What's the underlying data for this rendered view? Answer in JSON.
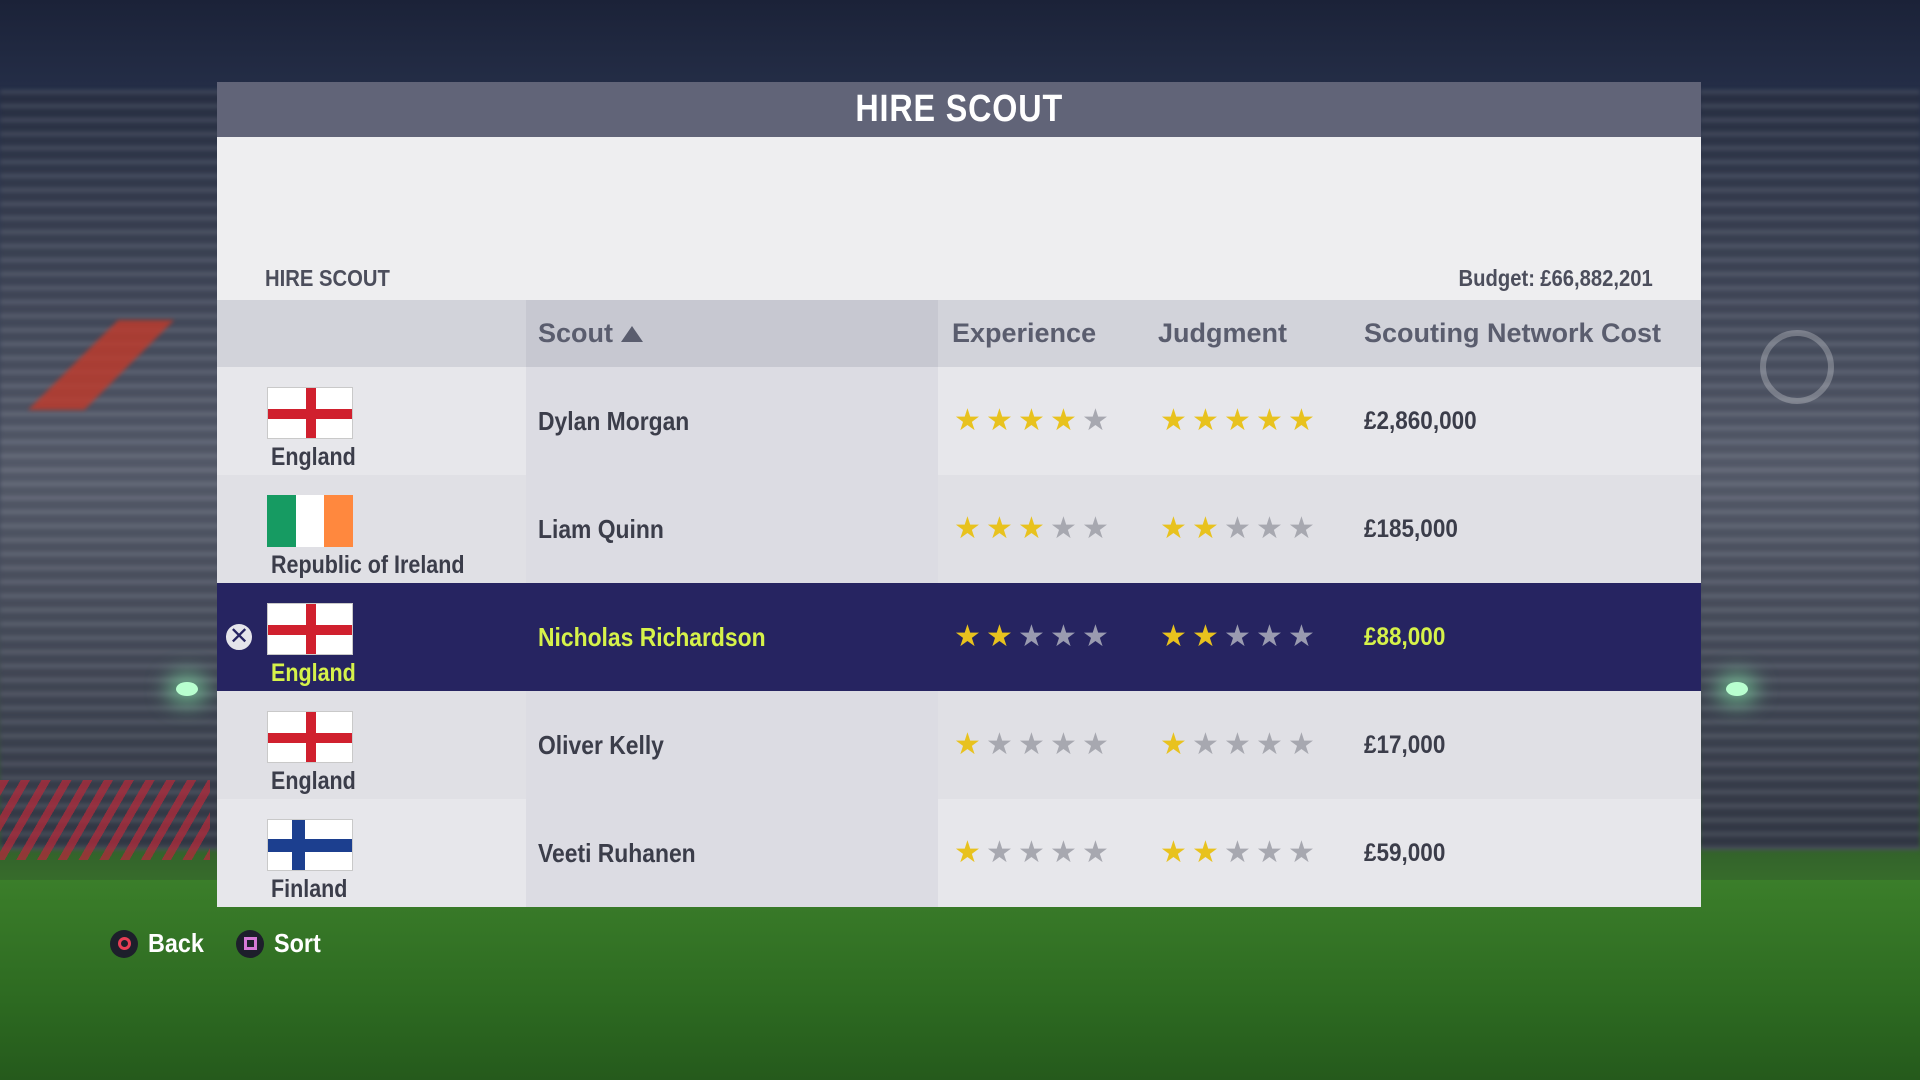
{
  "header": {
    "title": "HIRE SCOUT"
  },
  "section": {
    "title": "HIRE SCOUT",
    "budget_label": "Budget:",
    "budget_value": "£66,882,201"
  },
  "columns": {
    "scout": "Scout",
    "experience": "Experience",
    "judgment": "Judgment",
    "cost": "Scouting Network Cost"
  },
  "sort": {
    "column": "Scout",
    "direction": "ascending"
  },
  "scouts": [
    {
      "country": "England",
      "flag": "england-flag-icon",
      "name": "Dylan Morgan",
      "experience": 4,
      "judgment": 5,
      "cost": "£2,860,000",
      "selected": false
    },
    {
      "country": "Republic of Ireland",
      "flag": "ireland-flag-icon",
      "name": "Liam Quinn",
      "experience": 3,
      "judgment": 2,
      "cost": "£185,000",
      "selected": false
    },
    {
      "country": "England",
      "flag": "england-flag-icon",
      "name": "Nicholas Richardson",
      "experience": 2,
      "judgment": 2,
      "cost": "£88,000",
      "selected": true
    },
    {
      "country": "England",
      "flag": "england-flag-icon",
      "name": "Oliver Kelly",
      "experience": 1,
      "judgment": 1,
      "cost": "£17,000",
      "selected": false
    },
    {
      "country": "Finland",
      "flag": "finland-flag-icon",
      "name": "Veeti Ruhanen",
      "experience": 1,
      "judgment": 2,
      "cost": "£59,000",
      "selected": false
    }
  ],
  "max_stars": 5,
  "footer": {
    "back_label": "Back",
    "back_icon": "circle-button-icon",
    "sort_label": "Sort",
    "sort_icon": "square-button-icon"
  },
  "colors": {
    "header_bg": "#616478",
    "selected_row_bg": "#262461",
    "selected_text": "#d6f24a",
    "star_on": "#e8c21e",
    "star_off": "#a7a8b0"
  }
}
